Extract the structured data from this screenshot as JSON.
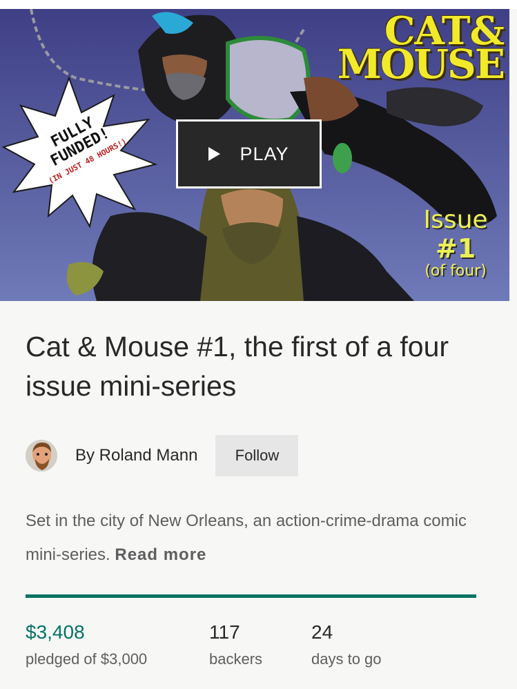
{
  "hero": {
    "title_line1": "CAT&",
    "title_line2": "MOUSE",
    "issue_line1": "Issue",
    "issue_line2": "#1",
    "issue_line3": "(of four)",
    "burst_line1": "FULLY FUNDED!",
    "burst_line2": "(IN JUST 48 HOURS!)",
    "play_label": "PLAY",
    "play_icon": "play-triangle-icon"
  },
  "project": {
    "title": "Cat & Mouse #1, the first of a four issue mini-series"
  },
  "creator": {
    "name": "By Roland Mann",
    "follow_label": "Follow",
    "avatar_icon": "creator-avatar"
  },
  "blurb": {
    "text": "Set in the city of New Orleans, an action-crime-drama comic mini-series. ",
    "read_more": "Read more"
  },
  "funding": {
    "progress": 1.0,
    "pledged_value": "$3,408",
    "pledged_label": "pledged of $3,000",
    "backers_value": "117",
    "backers_label": "backers",
    "days_value": "24",
    "days_label": "days to go"
  },
  "colors": {
    "accent": "#037362",
    "text": "#282828",
    "muted": "#5e5e5e",
    "button_bg": "#e6e6e6",
    "play_bg": "#282828"
  }
}
